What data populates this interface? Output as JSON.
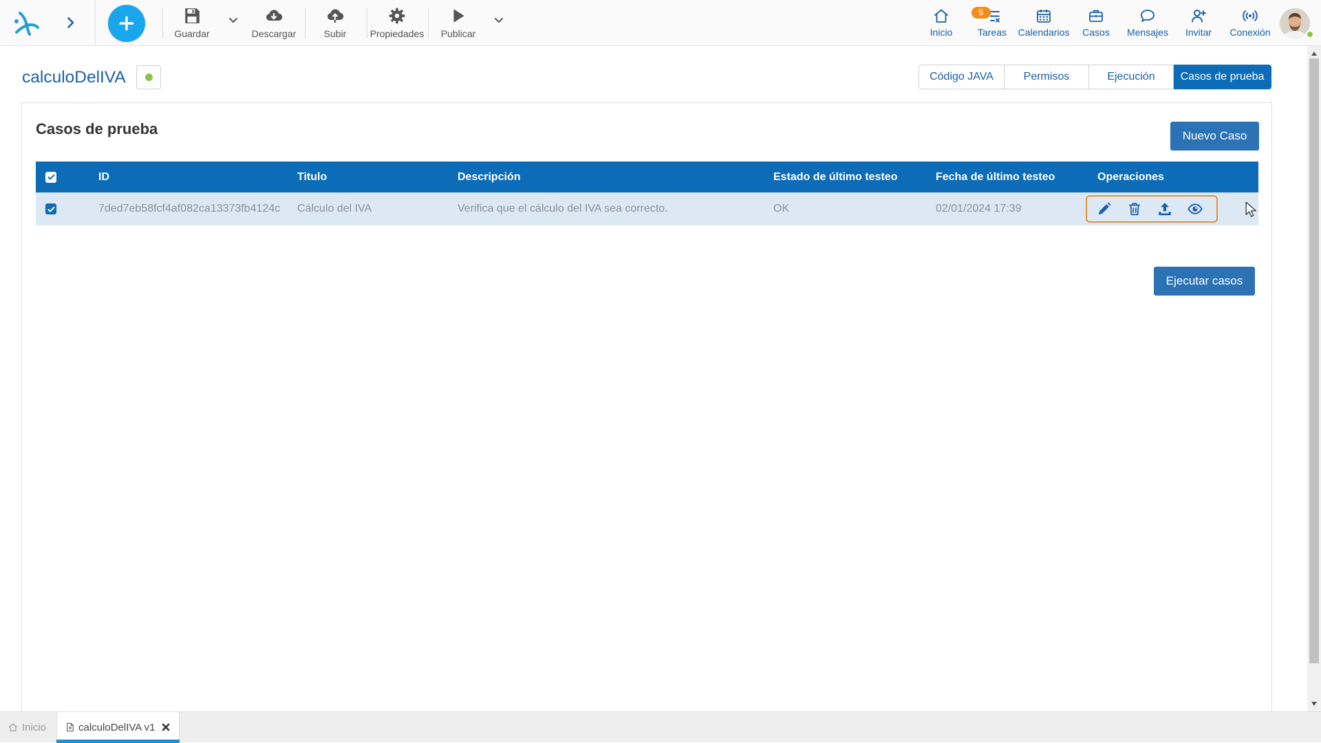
{
  "colors": {
    "primary": "#0c6cb7",
    "button": "#2c73b6",
    "accent": "#1aa6ec",
    "logo": "#1e9fd6",
    "highlight": "#e8912d",
    "badge": "#f28c1e",
    "status": "#8bc34a",
    "nav_text": "#1a5fa8",
    "row_bg": "#dce9f5",
    "row_text": "#8c9197",
    "tab_underline": "#1a8fd8"
  },
  "toolbar": {
    "logo_icon": "deyel-logo-icon",
    "expand_icon": "chevron-right-icon",
    "create_icon": "plus-icon",
    "left_buttons": [
      {
        "label": "Guardar",
        "icon": "save-icon",
        "has_dropdown": true
      },
      {
        "label": "Descargar",
        "icon": "cloud-download-icon",
        "has_dropdown": false
      },
      {
        "label": "Subir",
        "icon": "cloud-upload-icon",
        "has_dropdown": false
      },
      {
        "label": "Propiedades",
        "icon": "gear-icon",
        "has_dropdown": false
      },
      {
        "label": "Publicar",
        "icon": "play-icon",
        "has_dropdown": true
      }
    ],
    "right_nav": [
      {
        "label": "Inicio",
        "icon": "home-icon"
      },
      {
        "label": "Tareas",
        "icon": "tasks-icon",
        "badge": "5"
      },
      {
        "label": "Calendarios",
        "icon": "calendar-icon"
      },
      {
        "label": "Casos",
        "icon": "briefcase-icon"
      },
      {
        "label": "Mensajes",
        "icon": "chat-icon"
      },
      {
        "label": "Invitar",
        "icon": "add-user-icon"
      },
      {
        "label": "Conexión",
        "icon": "broadcast-icon"
      }
    ],
    "user_icon": "user-avatar-icon",
    "user_online": true
  },
  "page": {
    "title": "calculoDelIVA",
    "status_icon": "status-dot-icon",
    "tabs": [
      {
        "label": "Código JAVA",
        "active": false
      },
      {
        "label": "Permisos",
        "active": false
      },
      {
        "label": "Ejecución",
        "active": false
      },
      {
        "label": "Casos de prueba",
        "active": true
      }
    ]
  },
  "panel": {
    "heading": "Casos de prueba",
    "new_case_label": "Nuevo Caso",
    "run_cases_label": "Ejecutar casos",
    "table": {
      "header_checked": true,
      "headers": [
        "ID",
        "Titulo",
        "Descripción",
        "Estado de último testeo",
        "Fecha de último testeo",
        "Operaciones"
      ],
      "rows": [
        {
          "checked": true,
          "id": "7ded7eb58fcf4af082ca13373fb4124c",
          "titulo": "Cálculo del IVA",
          "descripcion": "Verifica que el cálculo del IVA sea correcto.",
          "estado": "OK",
          "fecha": "02/01/2024 17:39",
          "operations": [
            "edit-icon",
            "trash-icon",
            "upload-icon",
            "eye-icon"
          ],
          "operations_highlighted": true
        }
      ]
    }
  },
  "bottom_tabs": [
    {
      "label": "Inicio",
      "icon": "home-icon",
      "active": false
    },
    {
      "label": "calculoDelIVA v1",
      "icon": "document-icon",
      "active": true,
      "closable": true
    }
  ]
}
